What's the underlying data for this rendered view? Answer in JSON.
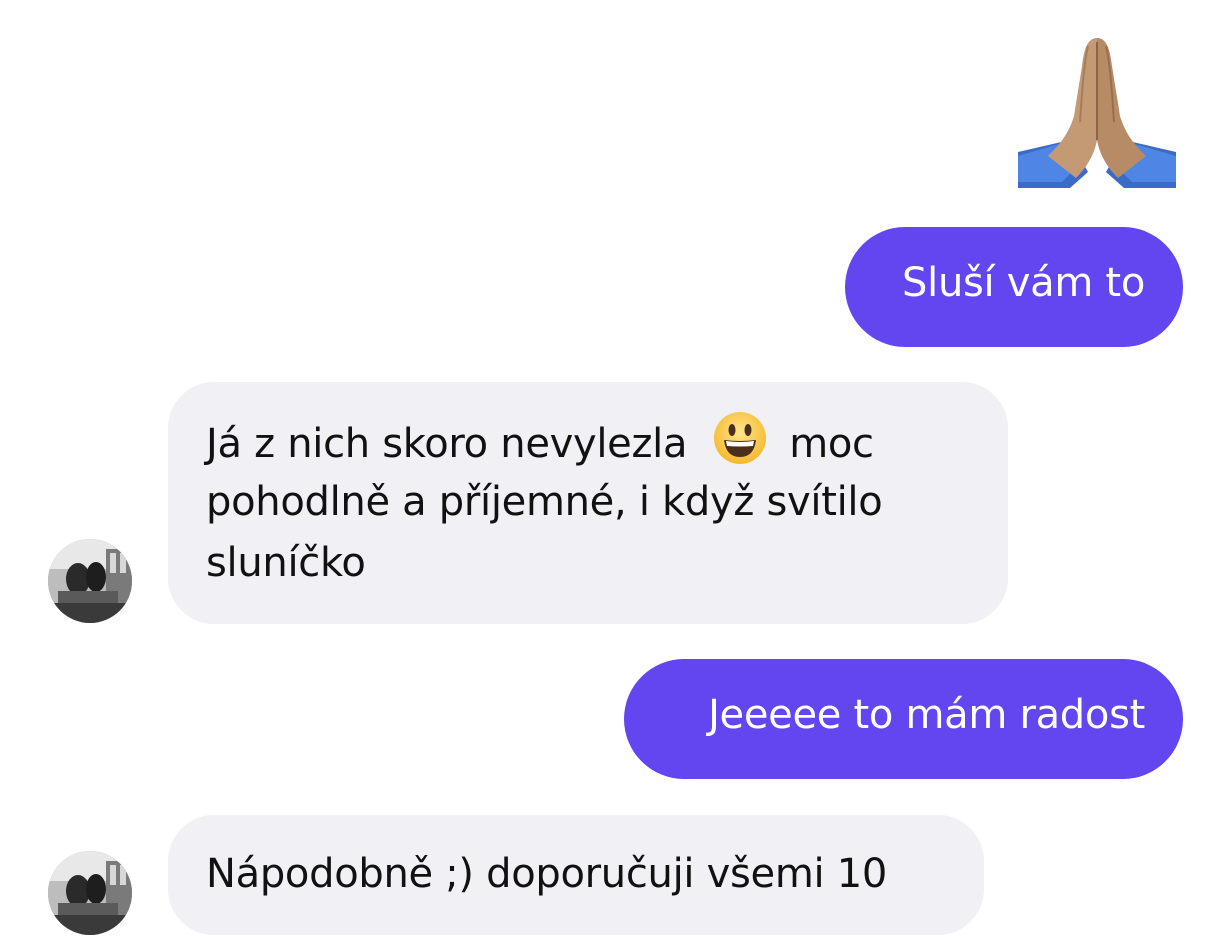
{
  "messages": [
    {
      "id": "m1",
      "direction": "outgoing",
      "emoji": "folded-hands"
    },
    {
      "id": "m2",
      "direction": "outgoing",
      "text": "Sluší vám to"
    },
    {
      "id": "m3",
      "direction": "incoming",
      "line1_before": "Já z nich skoro nevylezla",
      "line1_emoji": "grinning-face",
      "line1_after": "moc",
      "line2": "pohodlně a příjemné, i když svítilo",
      "line3": "sluníčko"
    },
    {
      "id": "m4",
      "direction": "outgoing",
      "text": "Jeeeee to mám radost"
    },
    {
      "id": "m5",
      "direction": "incoming",
      "text": "Nápodobně ;) doporučuji všemi 10"
    }
  ],
  "colors": {
    "outgoing_bubble": "#6446f0",
    "incoming_bubble": "#f0f0f5",
    "outgoing_text": "#ffffff",
    "incoming_text": "#111111"
  }
}
